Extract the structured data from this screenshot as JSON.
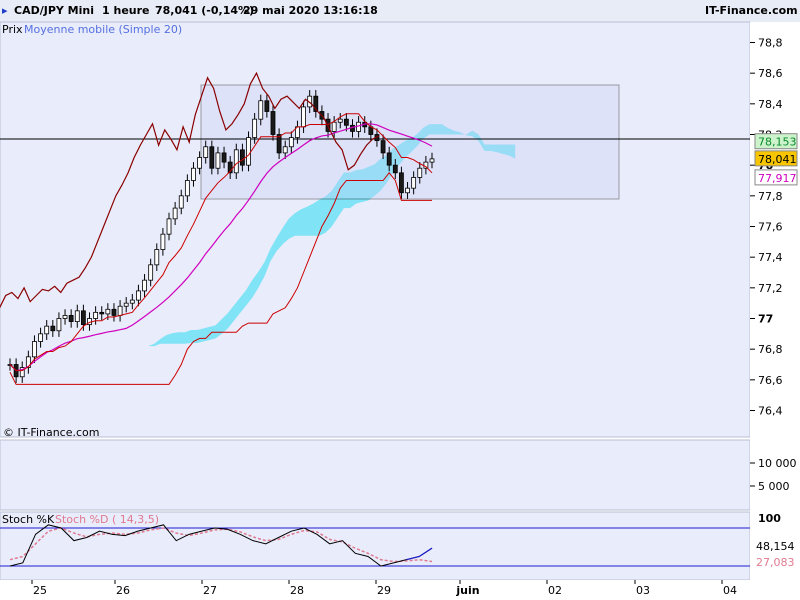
{
  "header": {
    "instrument": "CAD/JPY Mini",
    "timeframe": "1 heure",
    "quote": "78,041 (-0,14%)",
    "datetime": "29 mai 2020 13:16:18",
    "site": "IT-Finance.com"
  },
  "legend": {
    "price": "Prix",
    "ma": "Moyenne mobile (Simple 20)"
  },
  "watermark": "© IT-Finance.com",
  "colors": {
    "bg": "#e9ecfb",
    "panel": "#dfe4fa",
    "candle_up": "#ffffff",
    "candle_down": "#1a1a1a",
    "ma": "#d000c0",
    "tenkan": "#cc0000",
    "kijun": "#8b0000",
    "cloud_bull": "#66dd88",
    "cloud_bear": "#5ce0f4",
    "price_tag": "#f7c600"
  },
  "price_axis": {
    "ticks": [
      "78,8",
      "78,6",
      "78,4",
      "78,2",
      "78",
      "77,8",
      "77,6",
      "77,4",
      "77,2",
      "77",
      "76,8",
      "76,6",
      "76,4"
    ],
    "ylim": [
      76.4,
      78.8
    ],
    "current_tag": "78,041",
    "cloud_tag": "78,153",
    "ma_tag": "77,917"
  },
  "volume_axis": {
    "ticks": [
      "10 000",
      "5 000"
    ]
  },
  "stoch": {
    "label_k": "Stoch %K",
    "label_d": "Stoch %D ( 14,3,5)",
    "top_tick": "100",
    "k_value": "48,154",
    "d_value": "27,083"
  },
  "x_axis": {
    "ticks": [
      "25",
      "26",
      "27",
      "28",
      "29",
      "juin",
      "02",
      "03",
      "04"
    ]
  },
  "chart_data": {
    "type": "candlestick",
    "instrument": "CAD/JPY",
    "interval": "1 heure",
    "ylim": [
      76.4,
      78.8
    ],
    "closes": [
      76.7,
      76.62,
      76.68,
      76.75,
      76.85,
      76.9,
      76.95,
      76.92,
      77,
      77.02,
      76.98,
      77.05,
      76.96,
      77,
      77.04,
      77.03,
      77.06,
      77.02,
      77.08,
      77.1,
      77.12,
      77.18,
      77.25,
      77.35,
      77.45,
      77.55,
      77.65,
      77.72,
      77.8,
      77.9,
      77.98,
      78.05,
      78.12,
      77.98,
      78.08,
      78.02,
      77.95,
      78.1,
      78.0,
      78.18,
      78.3,
      78.42,
      78.35,
      78.2,
      78.08,
      78.12,
      78.18,
      78.25,
      78.38,
      78.45,
      78.35,
      78.3,
      78.22,
      78.28,
      78.3,
      78.26,
      78.22,
      78.28,
      78.25,
      78.2,
      78.16,
      78.08,
      78.0,
      77.95,
      77.82,
      77.85,
      77.92,
      77.98,
      78.02,
      78.041
    ],
    "ma_last": 77.917,
    "cloud_last": 78.153,
    "stoch_k": [
      20,
      25,
      70,
      85,
      80,
      60,
      65,
      75,
      70,
      68,
      75,
      80,
      85,
      60,
      70,
      75,
      80,
      78,
      70,
      60,
      55,
      65,
      75,
      80,
      70,
      55,
      60,
      40,
      35,
      20,
      25,
      30,
      35,
      48.154
    ],
    "stoch_d": [
      30,
      35,
      55,
      75,
      80,
      72,
      66,
      70,
      72,
      70,
      72,
      77,
      80,
      72,
      68,
      72,
      77,
      78,
      74,
      66,
      60,
      62,
      70,
      76,
      74,
      62,
      58,
      48,
      40,
      30,
      27,
      28,
      30,
      27.083
    ]
  }
}
